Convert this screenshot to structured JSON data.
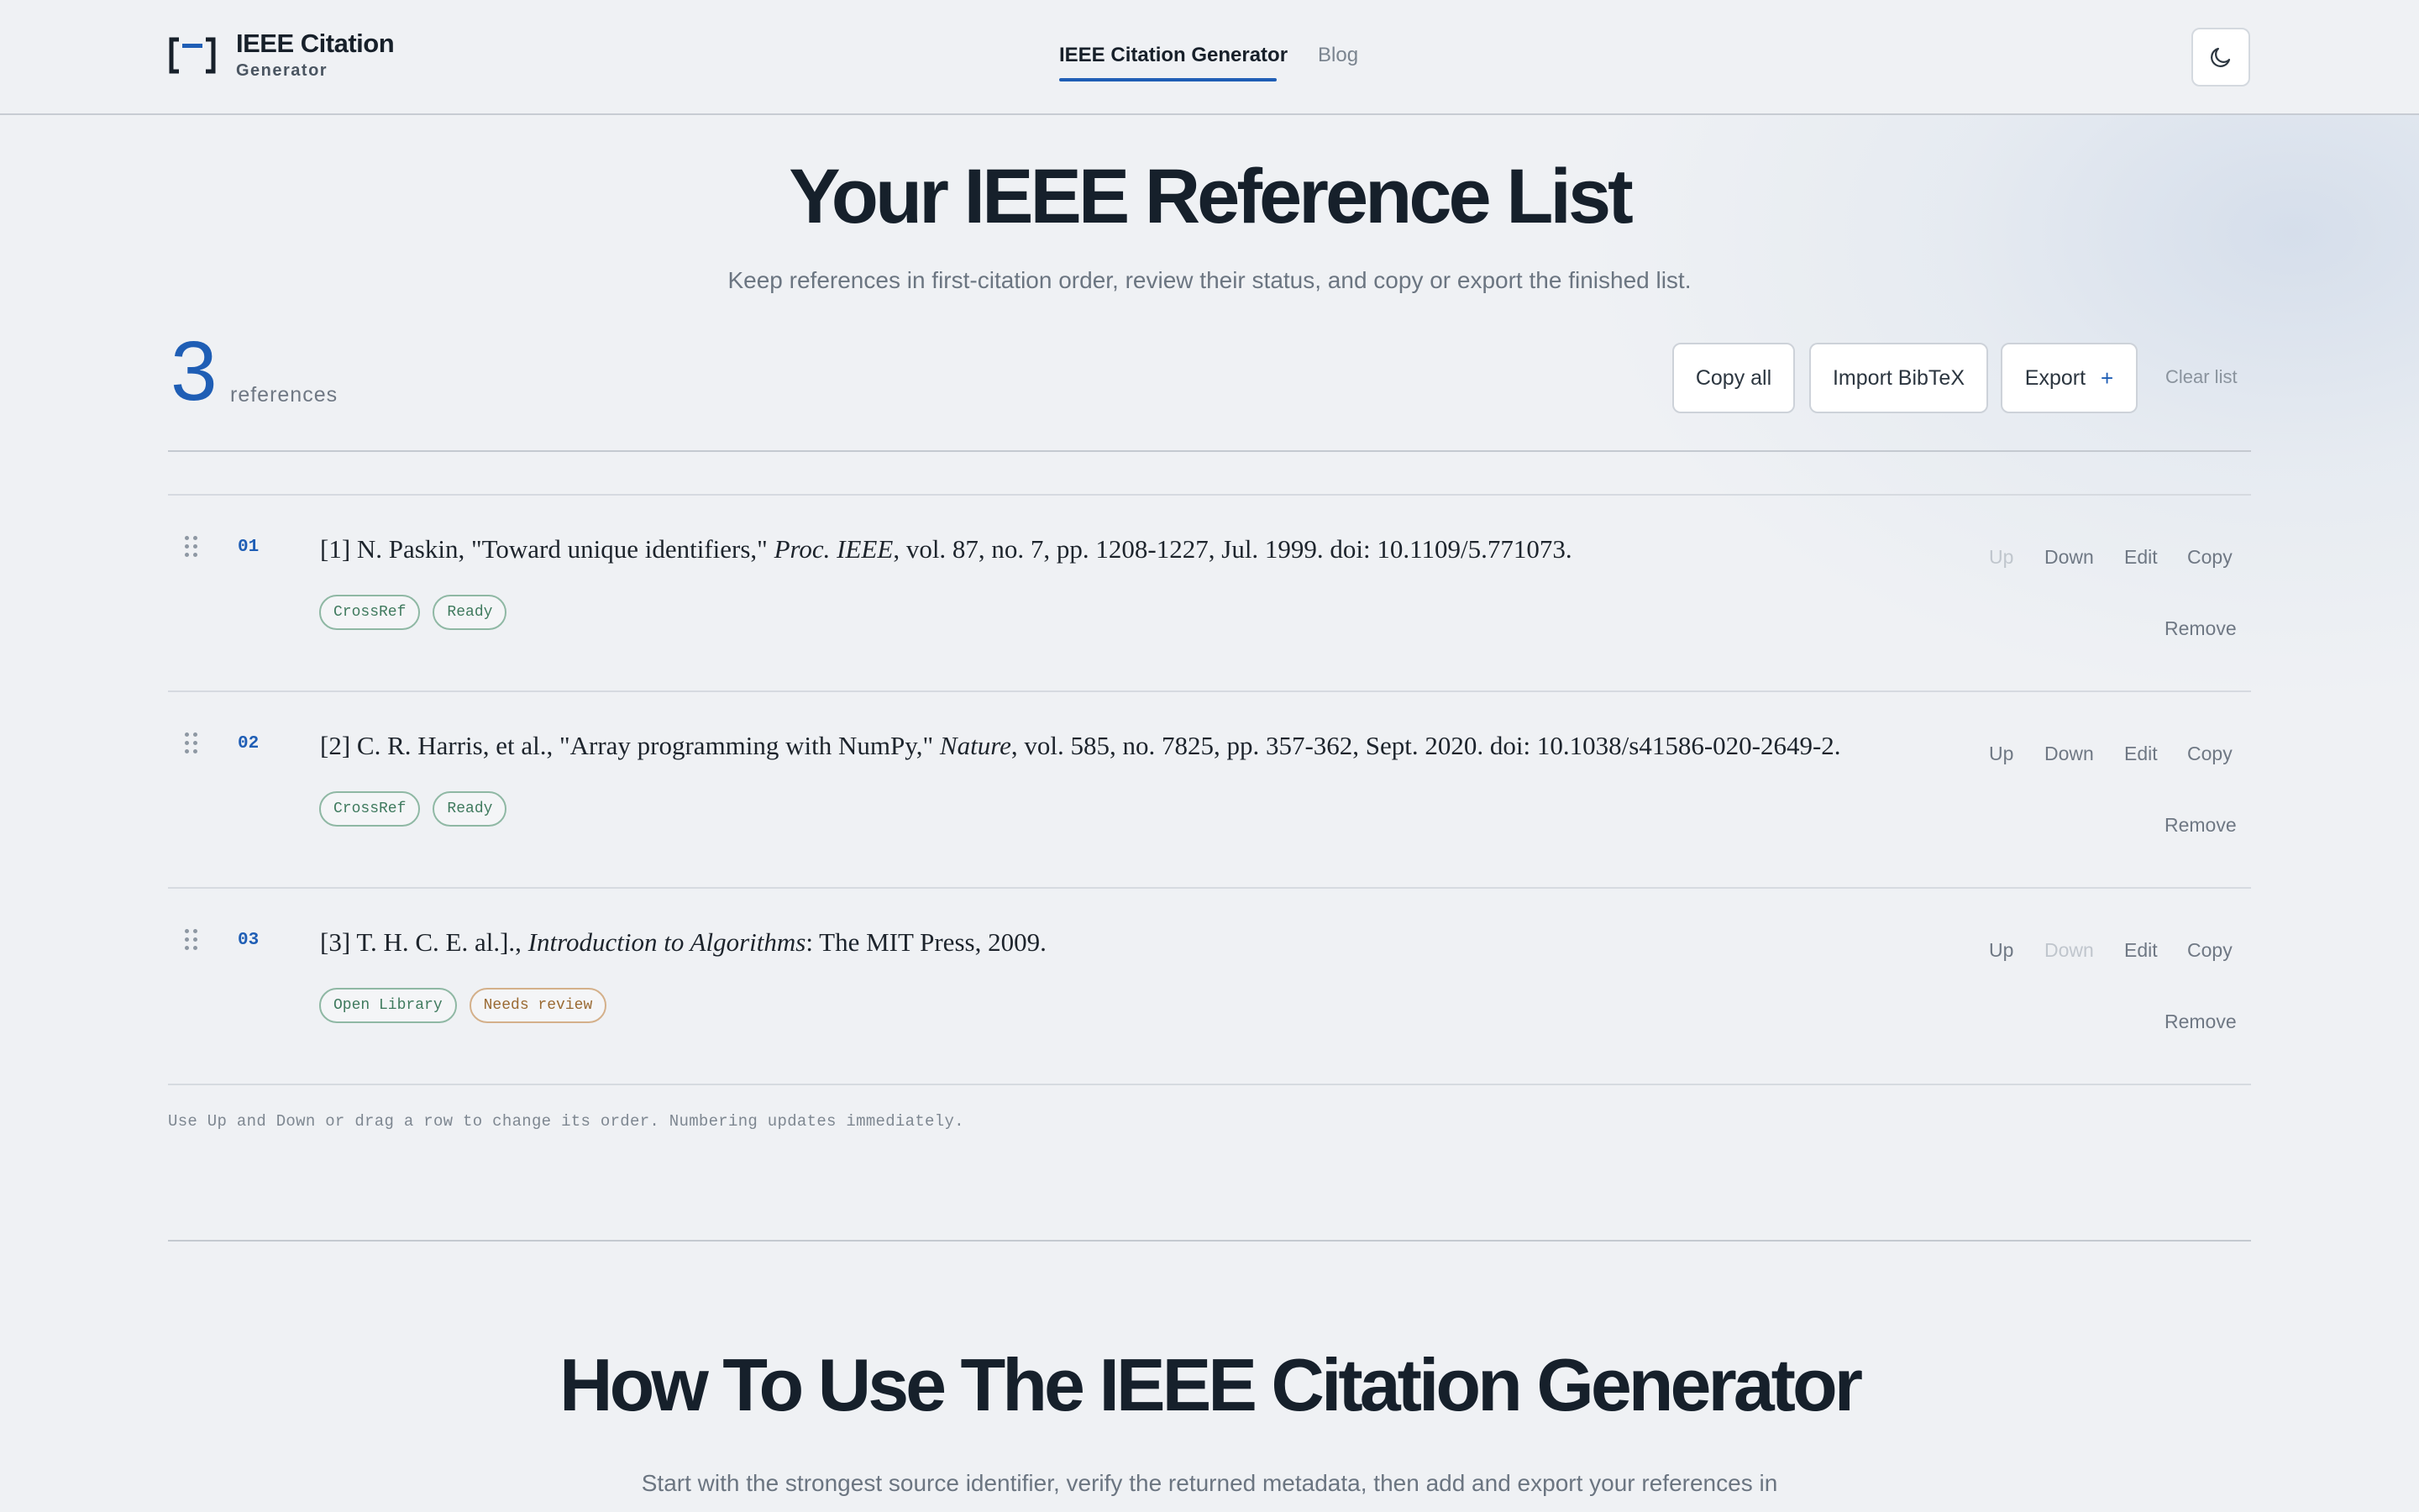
{
  "header": {
    "logo_title": "IEEE Citation",
    "logo_sub": "Generator",
    "nav": [
      {
        "label": "IEEE Citation Generator",
        "active": true
      },
      {
        "label": "Blog",
        "active": false
      }
    ],
    "theme_icon": "moon-icon"
  },
  "hero": {
    "title": "Your IEEE Reference List",
    "subtitle": "Keep references in first-citation order, review their status, and copy or export the finished list."
  },
  "summary": {
    "count": "3",
    "count_label": "references",
    "copy_all": "Copy all",
    "import_bibtex": "Import BibTeX",
    "export": "Export",
    "export_icon": "+",
    "clear_list": "Clear list"
  },
  "references": [
    {
      "num": "01",
      "pre": "[1] N. Paskin, \"Toward unique identifiers,\" ",
      "italic": "Proc. IEEE",
      "post": ", vol. 87, no. 7, pp. 1208-1227, Jul. 1999. doi: 10.1109/5.771073.",
      "tags": [
        "CrossRef",
        "Ready"
      ],
      "up_disabled": true,
      "down_disabled": false
    },
    {
      "num": "02",
      "pre": "[2] C. R. Harris, et al., \"Array programming with NumPy,\" ",
      "italic": "Nature",
      "post": ", vol. 585, no. 7825, pp. 357-362, Sept. 2020. doi: 10.1038/s41586-020-2649-2.",
      "tags": [
        "CrossRef",
        "Ready"
      ],
      "up_disabled": false,
      "down_disabled": false
    },
    {
      "num": "03",
      "pre": "[3] T. H. C. E. al.]., ",
      "italic": "Introduction to Algorithms",
      "post": ": The MIT Press, 2009.",
      "tags": [
        "Open Library",
        "Needs review"
      ],
      "up_disabled": false,
      "down_disabled": true
    }
  ],
  "row_actions": {
    "up": "Up",
    "down": "Down",
    "edit": "Edit",
    "copy": "Copy",
    "remove": "Remove"
  },
  "hint": "Use Up and Down or drag a row to change its order. Numbering updates immediately.",
  "how": {
    "title": "How To Use The IEEE Citation Generator",
    "subtitle": "Start with the strongest source identifier, verify the returned metadata, then add and export your references in"
  },
  "colors": {
    "accent": "#1f5eb5",
    "ready_tag": "#3f7a5e",
    "review_tag": "#9a6a33"
  }
}
